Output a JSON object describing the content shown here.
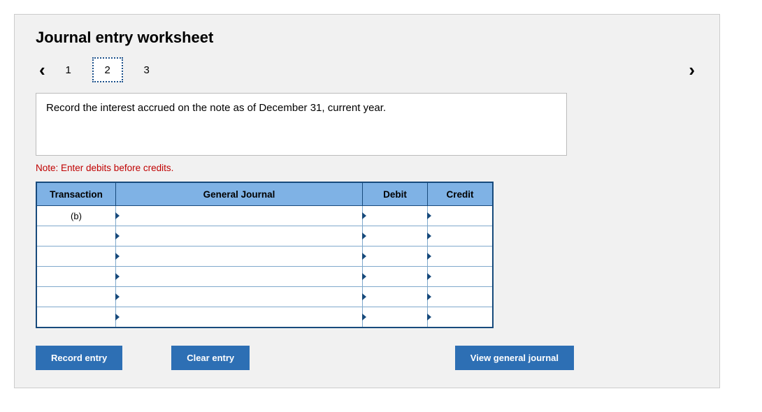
{
  "title": "Journal entry worksheet",
  "nav": {
    "steps": [
      "1",
      "2",
      "3"
    ],
    "current_index": 1
  },
  "instruction": "Record the interest accrued on the note as of December 31, current year.",
  "note": "Note: Enter debits before credits.",
  "table": {
    "headers": {
      "transaction": "Transaction",
      "general_journal": "General Journal",
      "debit": "Debit",
      "credit": "Credit"
    },
    "rows": [
      {
        "transaction": "(b)",
        "gj": "",
        "debit": "",
        "credit": ""
      },
      {
        "transaction": "",
        "gj": "",
        "debit": "",
        "credit": ""
      },
      {
        "transaction": "",
        "gj": "",
        "debit": "",
        "credit": ""
      },
      {
        "transaction": "",
        "gj": "",
        "debit": "",
        "credit": ""
      },
      {
        "transaction": "",
        "gj": "",
        "debit": "",
        "credit": ""
      },
      {
        "transaction": "",
        "gj": "",
        "debit": "",
        "credit": ""
      }
    ]
  },
  "buttons": {
    "record": "Record entry",
    "clear": "Clear entry",
    "view": "View general journal"
  }
}
